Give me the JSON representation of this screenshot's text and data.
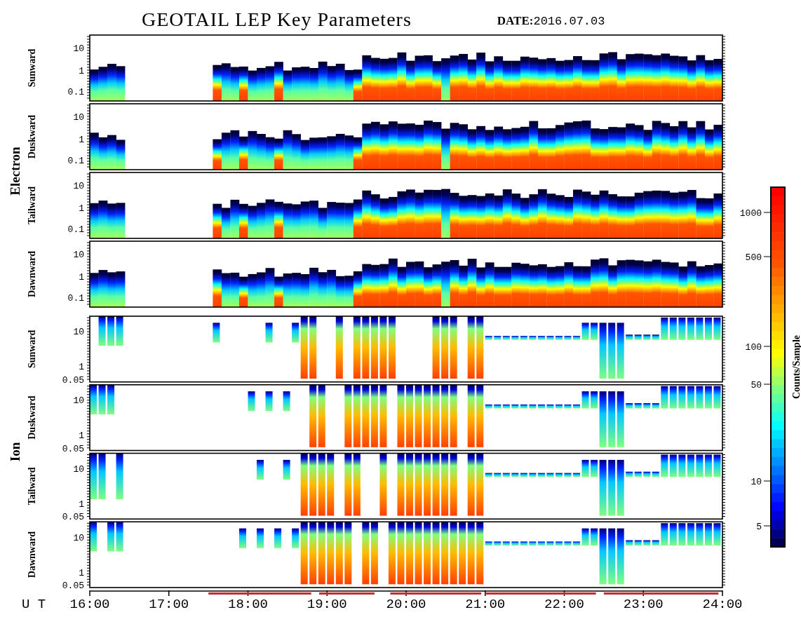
{
  "title": "GEOTAIL LEP Key Parameters",
  "date": "**DATE:**2016.07.03",
  "groups": [
    {
      "label": "Electron",
      "kind": "electron",
      "panels": [
        {
          "label": "Sunward",
          "yticks": [
            "10",
            "1",
            "0.1"
          ]
        },
        {
          "label": "Duskward",
          "yticks": [
            "10",
            "1",
            "0.1"
          ]
        },
        {
          "label": "Tailward",
          "yticks": [
            "10",
            "1",
            "0.1"
          ]
        },
        {
          "label": "Dawnward",
          "yticks": [
            "10",
            "1",
            "0.1"
          ]
        }
      ]
    },
    {
      "label": "Ion",
      "kind": "ion",
      "panels": [
        {
          "label": "Sunward",
          "yticks": [
            "10",
            "1",
            "0.05"
          ]
        },
        {
          "label": "Duskward",
          "yticks": [
            "10",
            "1",
            "0.05"
          ]
        },
        {
          "label": "Tailward",
          "yticks": [
            "10",
            "1",
            "0.05"
          ]
        },
        {
          "label": "Dawnward",
          "yticks": [
            "10",
            "1",
            "0.05"
          ]
        }
      ]
    }
  ],
  "x_axis": {
    "label": "U T",
    "ticks": [
      "16:00",
      "17:00",
      "18:00",
      "19:00",
      "20:00",
      "21:00",
      "22:00",
      "23:00",
      "24:00"
    ]
  },
  "colorbar": {
    "label": "Counts/Sample",
    "ticks": [
      "1000",
      "500",
      "100",
      "50",
      "10",
      "5"
    ]
  }
}
